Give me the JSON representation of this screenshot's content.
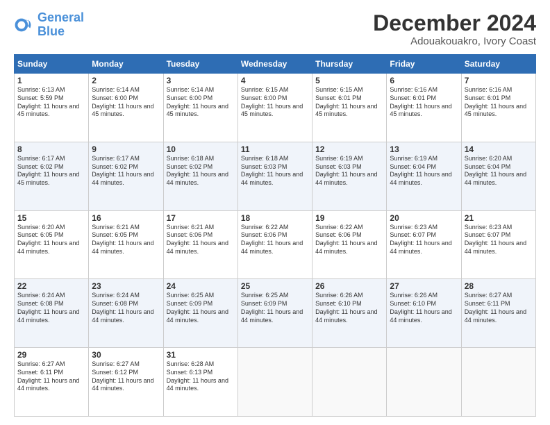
{
  "logo": {
    "line1": "General",
    "line2": "Blue"
  },
  "title": "December 2024",
  "subtitle": "Adouakouakro, Ivory Coast",
  "days_header": [
    "Sunday",
    "Monday",
    "Tuesday",
    "Wednesday",
    "Thursday",
    "Friday",
    "Saturday"
  ],
  "weeks": [
    [
      {
        "day": "1",
        "sunrise": "6:13 AM",
        "sunset": "5:59 PM",
        "daylight": "11 hours and 45 minutes."
      },
      {
        "day": "2",
        "sunrise": "6:14 AM",
        "sunset": "6:00 PM",
        "daylight": "11 hours and 45 minutes."
      },
      {
        "day": "3",
        "sunrise": "6:14 AM",
        "sunset": "6:00 PM",
        "daylight": "11 hours and 45 minutes."
      },
      {
        "day": "4",
        "sunrise": "6:15 AM",
        "sunset": "6:00 PM",
        "daylight": "11 hours and 45 minutes."
      },
      {
        "day": "5",
        "sunrise": "6:15 AM",
        "sunset": "6:01 PM",
        "daylight": "11 hours and 45 minutes."
      },
      {
        "day": "6",
        "sunrise": "6:16 AM",
        "sunset": "6:01 PM",
        "daylight": "11 hours and 45 minutes."
      },
      {
        "day": "7",
        "sunrise": "6:16 AM",
        "sunset": "6:01 PM",
        "daylight": "11 hours and 45 minutes."
      }
    ],
    [
      {
        "day": "8",
        "sunrise": "6:17 AM",
        "sunset": "6:02 PM",
        "daylight": "11 hours and 45 minutes."
      },
      {
        "day": "9",
        "sunrise": "6:17 AM",
        "sunset": "6:02 PM",
        "daylight": "11 hours and 44 minutes."
      },
      {
        "day": "10",
        "sunrise": "6:18 AM",
        "sunset": "6:02 PM",
        "daylight": "11 hours and 44 minutes."
      },
      {
        "day": "11",
        "sunrise": "6:18 AM",
        "sunset": "6:03 PM",
        "daylight": "11 hours and 44 minutes."
      },
      {
        "day": "12",
        "sunrise": "6:19 AM",
        "sunset": "6:03 PM",
        "daylight": "11 hours and 44 minutes."
      },
      {
        "day": "13",
        "sunrise": "6:19 AM",
        "sunset": "6:04 PM",
        "daylight": "11 hours and 44 minutes."
      },
      {
        "day": "14",
        "sunrise": "6:20 AM",
        "sunset": "6:04 PM",
        "daylight": "11 hours and 44 minutes."
      }
    ],
    [
      {
        "day": "15",
        "sunrise": "6:20 AM",
        "sunset": "6:05 PM",
        "daylight": "11 hours and 44 minutes."
      },
      {
        "day": "16",
        "sunrise": "6:21 AM",
        "sunset": "6:05 PM",
        "daylight": "11 hours and 44 minutes."
      },
      {
        "day": "17",
        "sunrise": "6:21 AM",
        "sunset": "6:06 PM",
        "daylight": "11 hours and 44 minutes."
      },
      {
        "day": "18",
        "sunrise": "6:22 AM",
        "sunset": "6:06 PM",
        "daylight": "11 hours and 44 minutes."
      },
      {
        "day": "19",
        "sunrise": "6:22 AM",
        "sunset": "6:06 PM",
        "daylight": "11 hours and 44 minutes."
      },
      {
        "day": "20",
        "sunrise": "6:23 AM",
        "sunset": "6:07 PM",
        "daylight": "11 hours and 44 minutes."
      },
      {
        "day": "21",
        "sunrise": "6:23 AM",
        "sunset": "6:07 PM",
        "daylight": "11 hours and 44 minutes."
      }
    ],
    [
      {
        "day": "22",
        "sunrise": "6:24 AM",
        "sunset": "6:08 PM",
        "daylight": "11 hours and 44 minutes."
      },
      {
        "day": "23",
        "sunrise": "6:24 AM",
        "sunset": "6:08 PM",
        "daylight": "11 hours and 44 minutes."
      },
      {
        "day": "24",
        "sunrise": "6:25 AM",
        "sunset": "6:09 PM",
        "daylight": "11 hours and 44 minutes."
      },
      {
        "day": "25",
        "sunrise": "6:25 AM",
        "sunset": "6:09 PM",
        "daylight": "11 hours and 44 minutes."
      },
      {
        "day": "26",
        "sunrise": "6:26 AM",
        "sunset": "6:10 PM",
        "daylight": "11 hours and 44 minutes."
      },
      {
        "day": "27",
        "sunrise": "6:26 AM",
        "sunset": "6:10 PM",
        "daylight": "11 hours and 44 minutes."
      },
      {
        "day": "28",
        "sunrise": "6:27 AM",
        "sunset": "6:11 PM",
        "daylight": "11 hours and 44 minutes."
      }
    ],
    [
      {
        "day": "29",
        "sunrise": "6:27 AM",
        "sunset": "6:11 PM",
        "daylight": "11 hours and 44 minutes."
      },
      {
        "day": "30",
        "sunrise": "6:27 AM",
        "sunset": "6:12 PM",
        "daylight": "11 hours and 44 minutes."
      },
      {
        "day": "31",
        "sunrise": "6:28 AM",
        "sunset": "6:13 PM",
        "daylight": "11 hours and 44 minutes."
      },
      null,
      null,
      null,
      null
    ]
  ]
}
